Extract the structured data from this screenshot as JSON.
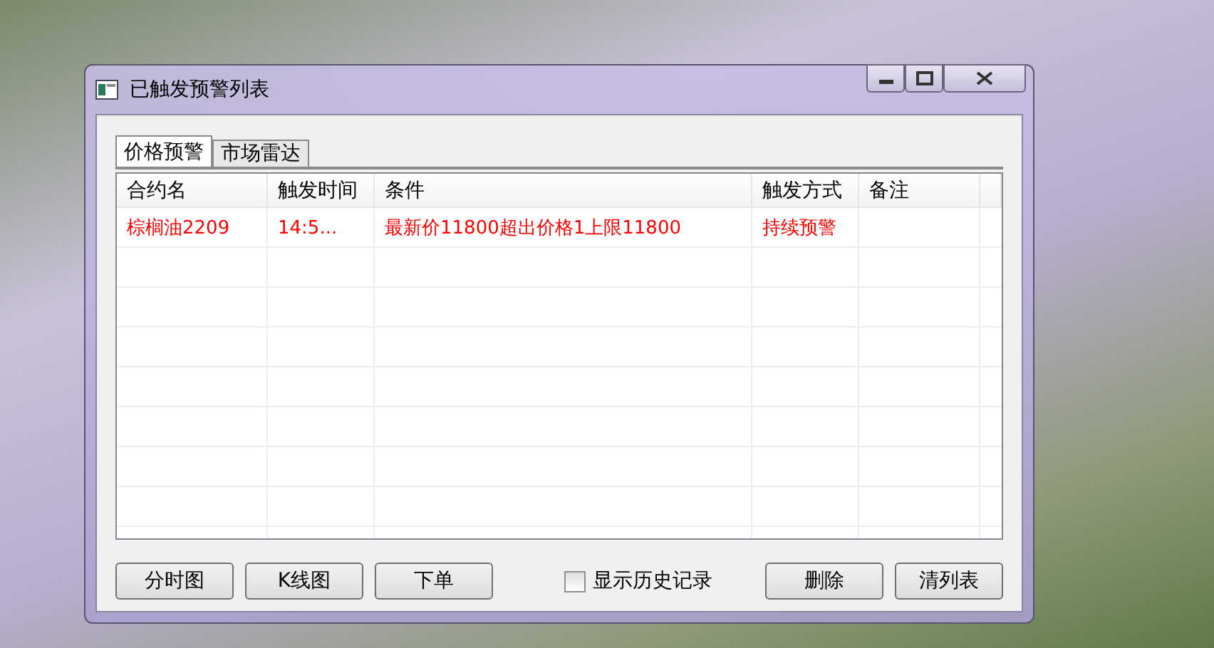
{
  "window": {
    "title": "已触发预警列表"
  },
  "tabs": [
    {
      "label": "价格预警",
      "selected": true
    },
    {
      "label": "市场雷达",
      "selected": false
    }
  ],
  "table": {
    "columns": [
      "合约名",
      "触发时间",
      "条件",
      "触发方式",
      "备注"
    ],
    "rows": [
      {
        "cells": [
          "棕榈油2209",
          "14:5...",
          "最新价11800超出价格1上限11800",
          "持续预警",
          ""
        ],
        "color": "#ff0000"
      }
    ]
  },
  "buttons_left": [
    "分时图",
    "K线图",
    "下单"
  ],
  "history_checkbox": {
    "label": "显示历史记录",
    "checked": false
  },
  "buttons_right": [
    "删除",
    "清列表"
  ]
}
